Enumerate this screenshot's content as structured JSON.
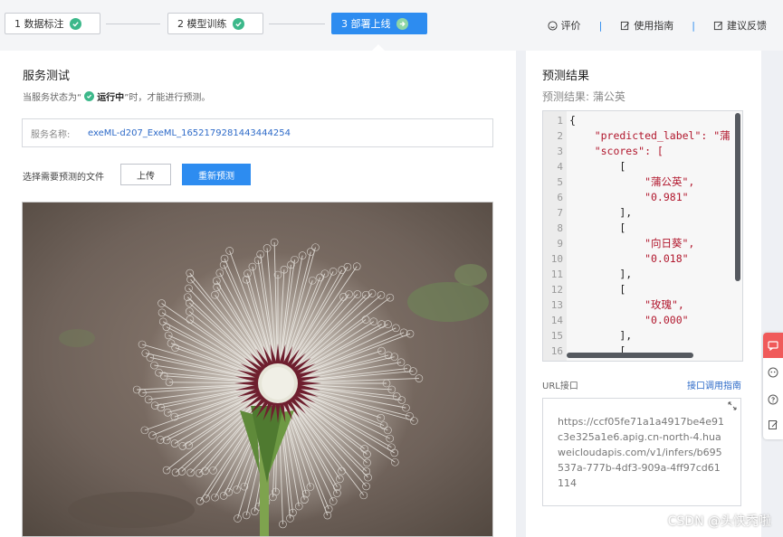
{
  "steps": [
    {
      "label": "1 数据标注",
      "state": "done"
    },
    {
      "label": "2 模型训练",
      "state": "done"
    },
    {
      "label": "3 部署上线",
      "state": "active"
    }
  ],
  "top_links": {
    "rate": "评价",
    "guide": "使用指南",
    "feedback": "建议反馈"
  },
  "left": {
    "title": "服务测试",
    "status_prefix": "当服务状态为“",
    "status_value": "运行中",
    "status_suffix": "”时，才能进行预测。",
    "service_label": "服务名称:",
    "service_name": "exeML-d207_ExeML_1652179281443444254",
    "file_label": "选择需要预测的文件",
    "upload_button": "上传",
    "repredict_button": "重新预测"
  },
  "right": {
    "title": "预测结果",
    "result_prefix": "预测结果:",
    "result_value": "蒲公英",
    "code_lines": [
      {
        "n": "1",
        "t": "{"
      },
      {
        "n": "2",
        "t": "    \"predicted_label\": \"蒲"
      },
      {
        "n": "3",
        "t": "    \"scores\": ["
      },
      {
        "n": "4",
        "t": "        ["
      },
      {
        "n": "5",
        "t": "            \"蒲公英\","
      },
      {
        "n": "6",
        "t": "            \"0.981\""
      },
      {
        "n": "7",
        "t": "        ],"
      },
      {
        "n": "8",
        "t": "        ["
      },
      {
        "n": "9",
        "t": "            \"向日葵\","
      },
      {
        "n": "10",
        "t": "            \"0.018\""
      },
      {
        "n": "11",
        "t": "        ],"
      },
      {
        "n": "12",
        "t": "        ["
      },
      {
        "n": "13",
        "t": "            \"玫瑰\","
      },
      {
        "n": "14",
        "t": "            \"0.000\""
      },
      {
        "n": "15",
        "t": "        ],"
      },
      {
        "n": "16",
        "t": "        ["
      }
    ],
    "url_label": "URL接口",
    "url_guide": "接口调用指南",
    "url_value": "https://ccf05fe71a1a4917be4e91c3e325a1e6.apig.cn-north-4.huaweicloudapis.com/v1/infers/b695537a-777b-4df3-909a-4ff97cd61114"
  },
  "watermark": "CSDN @头快秃啦",
  "colors": {
    "primary": "#2d8cf0",
    "success": "#3cb88a",
    "link": "#2d6ac8",
    "float_accent": "#f05a5a"
  }
}
